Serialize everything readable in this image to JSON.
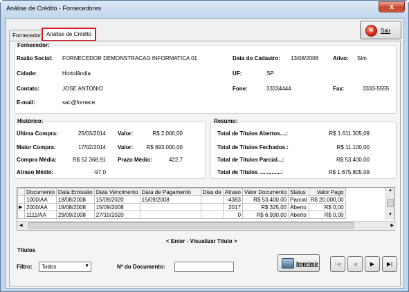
{
  "window": {
    "title": "Análise de Crédito - Fornecedores",
    "close_glyph": "x"
  },
  "tabs": [
    {
      "label": "Fornecedor"
    },
    {
      "label": "Análise de Crédito"
    }
  ],
  "sair": {
    "label": "Sair",
    "icon": "x-circle-icon"
  },
  "fornecedor": {
    "title": "Fornecedor:",
    "razao_label": "Razão Social:",
    "razao_value": "FORNECEDOR DEMONSTRACAO INFORMATICA 01",
    "data_cadastro_label": "Data do Cadastro:",
    "data_cadastro_value": "13/08/2008",
    "ativo_label": "Ativo:",
    "ativo_value": "Sim",
    "cidade_label": "Cidade:",
    "cidade_value": "Hortolândia",
    "uf_label": "UF:",
    "uf_value": "SP",
    "contato_label": "Contato:",
    "contato_value": "JOSE ANTONIO",
    "fone_label": "Fone:",
    "fone_value": "33334444",
    "fax_label": "Fax:",
    "fax_value": "3333-5555",
    "email_label": "E-mail:",
    "email_value": "sac@fornece"
  },
  "historico": {
    "title": "Histórico:",
    "ultima_label": "Última Compra:",
    "ultima_value": "25/03/2014",
    "ultima_valor_label": "Valor:",
    "ultima_valor_value": "R$ 2.000,00",
    "maior_label": "Maior Compra:",
    "maior_value": "17/02/2014",
    "maior_valor_label": "Valor:",
    "maior_valor_value": "R$ 693.000,00",
    "media_label": "Compra Média:",
    "media_value": "R$ 52.368,91",
    "prazo_label": "Prazo Médio:",
    "prazo_value": "422,7",
    "atraso_label": "Atraso Médio:",
    "atraso_value": "-97,0"
  },
  "resumo": {
    "title": "Resumo:",
    "rows": [
      {
        "label": "Total de Títulos Abertos....:",
        "value": "R$ 1.611.305,09"
      },
      {
        "label": "Total de Títulos Fechados.:",
        "value": "R$ 11.100,00"
      },
      {
        "label": "Total de Títulos Parcial...:",
        "value": "R$ 53.400,00"
      },
      {
        "label": "Total de Títulos ..............:",
        "value": "R$ 1.675.805,09"
      }
    ]
  },
  "grid": {
    "columns": [
      "Documento",
      "Data Emissão",
      "Data Vencimento",
      "Data de Pagamento",
      "Dias de",
      "Atraso",
      "Valor Documento",
      "Status",
      "Valor Pago"
    ],
    "rows": [
      [
        "1000/AA",
        "18/08/2008",
        "15/09/2020",
        "15/09/2008",
        "",
        "-4383",
        "R$ 53.400,00",
        "Parcial",
        "R$ 20.000,00"
      ],
      [
        "2000/AA",
        "18/08/2008",
        "15/09/2008",
        "",
        "",
        "2017",
        "R$ 325,00",
        "Aberto",
        "R$ 0,00"
      ],
      [
        "1111/AA",
        "29/09/2008",
        "27/10/2020",
        "",
        "",
        "0",
        "R$ 6.930,00",
        "Aberto",
        "R$ 0,00"
      ]
    ],
    "current_row_marker": "▶",
    "nav_hint": "< Enter - Visualizar Título >"
  },
  "titulos": {
    "title": "Títulos",
    "filtro_label": "Filtro:",
    "filtro_value": "Todos",
    "documento_label": "Nº do Documento:",
    "documento_value": "",
    "imprimir_label": "Imprimir"
  },
  "nav_buttons": [
    "|◀",
    "◀",
    "▶",
    "▶|"
  ]
}
